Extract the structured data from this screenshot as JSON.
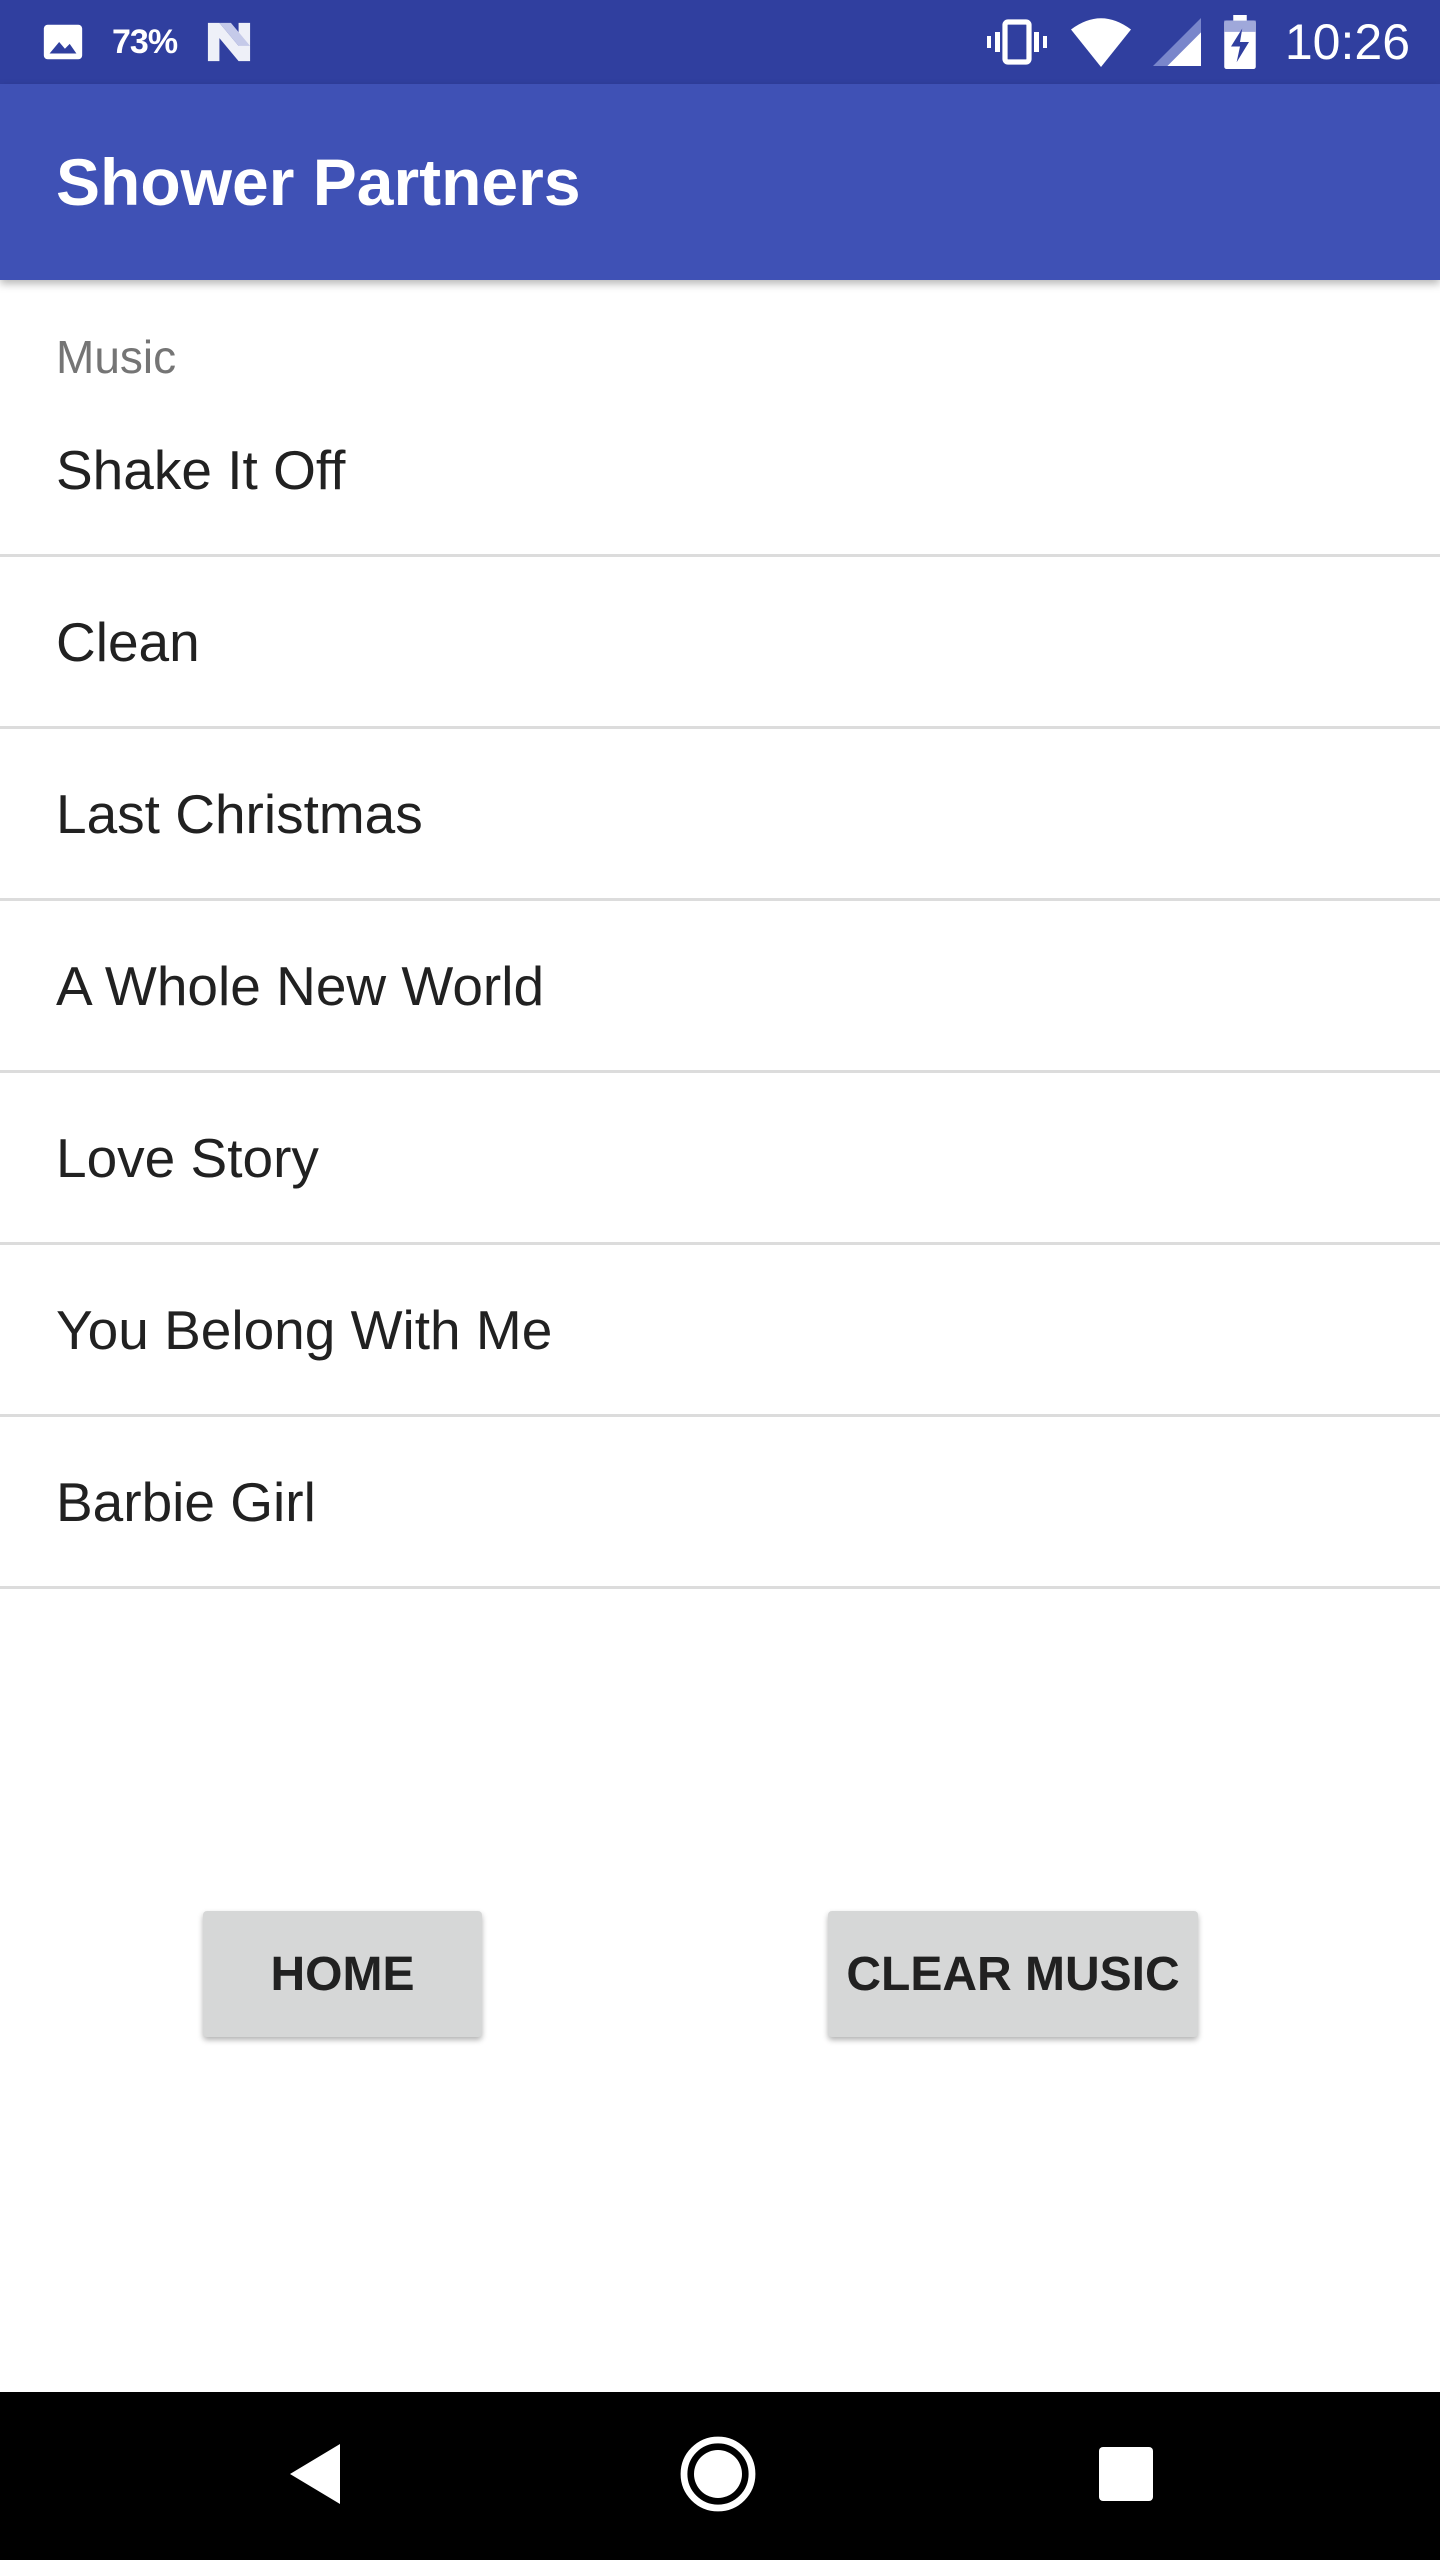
{
  "status_bar": {
    "battery_percent": "73%",
    "time": "10:26",
    "icons": [
      "image-icon",
      "n-logo-icon",
      "vibrate-icon",
      "wifi-icon",
      "cell-signal-icon",
      "battery-charging-icon"
    ]
  },
  "app_bar": {
    "title": "Shower Partners"
  },
  "list": {
    "category": "Music",
    "songs": [
      "Shake It Off",
      "Clean",
      "Last Christmas",
      "A Whole New World",
      "Love Story",
      "You Belong With Me",
      "Barbie Girl"
    ]
  },
  "buttons": {
    "home_label": "HOME",
    "clear_label": "CLEAR MUSIC"
  },
  "nav_bar": {
    "icons": [
      "back-icon",
      "home-circle-icon",
      "recents-icon"
    ]
  },
  "colors": {
    "status_bar": "#303F9F",
    "app_bar": "#3F51B5",
    "button": "#D6D7D7",
    "divider": "#DCDCDC"
  }
}
